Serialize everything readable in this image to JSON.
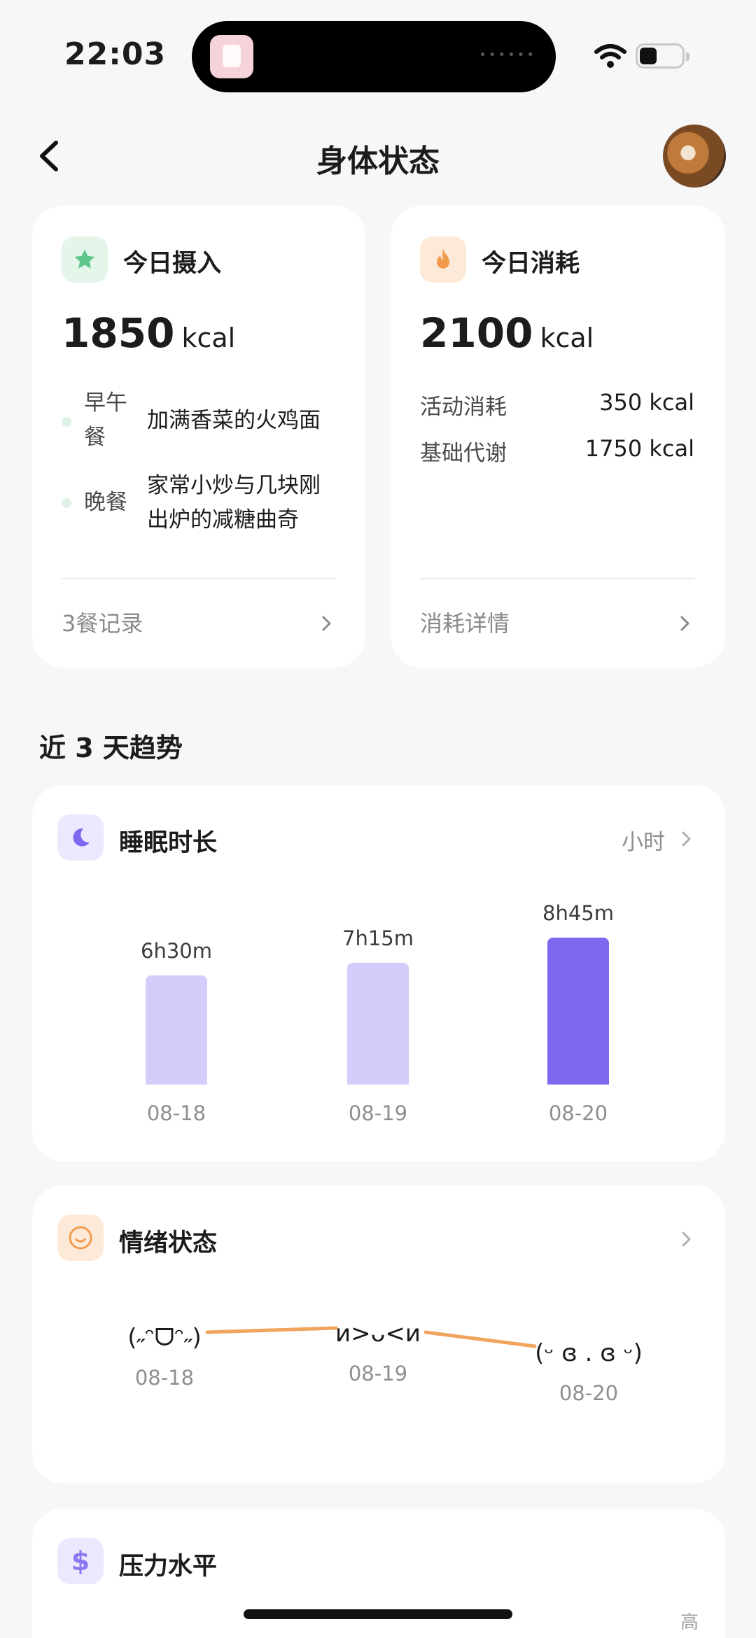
{
  "status_bar": {
    "time": "22:03"
  },
  "nav": {
    "title": "身体状态"
  },
  "intake_card": {
    "title": "今日摄入",
    "value": "1850",
    "unit": "kcal",
    "meals": [
      {
        "label": "早午\n餐",
        "text": "加满香菜的火鸡面"
      },
      {
        "label": "晚餐",
        "text": "家常小炒与几块刚\n出炉的减糖曲奇"
      }
    ],
    "footer_link": "3餐记录"
  },
  "burn_card": {
    "title": "今日消耗",
    "value": "2100",
    "unit": "kcal",
    "rows": [
      {
        "label": "活动消耗",
        "value": "350 kcal"
      },
      {
        "label": "基础代谢",
        "value": "1750 kcal"
      }
    ],
    "footer_link": "消耗详情"
  },
  "trend_section": {
    "title": "近 3 天趋势"
  },
  "sleep_card": {
    "title": "睡眠时长",
    "unit_link": "小时",
    "chart_data": {
      "type": "bar",
      "categories": [
        "08-18",
        "08-19",
        "08-20"
      ],
      "values": [
        6.5,
        7.25,
        8.75
      ],
      "data_labels": [
        "6h30m",
        "7h15m",
        "8h45m"
      ],
      "highlight_index": 2,
      "colors": {
        "normal": "#d4ccfa",
        "highlight": "#7f68f0"
      }
    }
  },
  "mood_card": {
    "title": "情绪状态",
    "points": [
      {
        "kaomoji": "(˶ᵔᗜᵔ˶)",
        "date": "08-18"
      },
      {
        "kaomoji": "ᴎ>ᴗ<ᴎ",
        "date": "08-19"
      },
      {
        "kaomoji": "(ᵕ ɞ . ɞ ᵕ)",
        "date": "08-20"
      }
    ],
    "line_color": "#f0a45d"
  },
  "stress_card": {
    "title": "压力水平",
    "axis_high": "高"
  },
  "colors": {
    "accent_green": "#5cc58a",
    "accent_orange": "#f29a4c",
    "accent_purple": "#7f68f0"
  }
}
